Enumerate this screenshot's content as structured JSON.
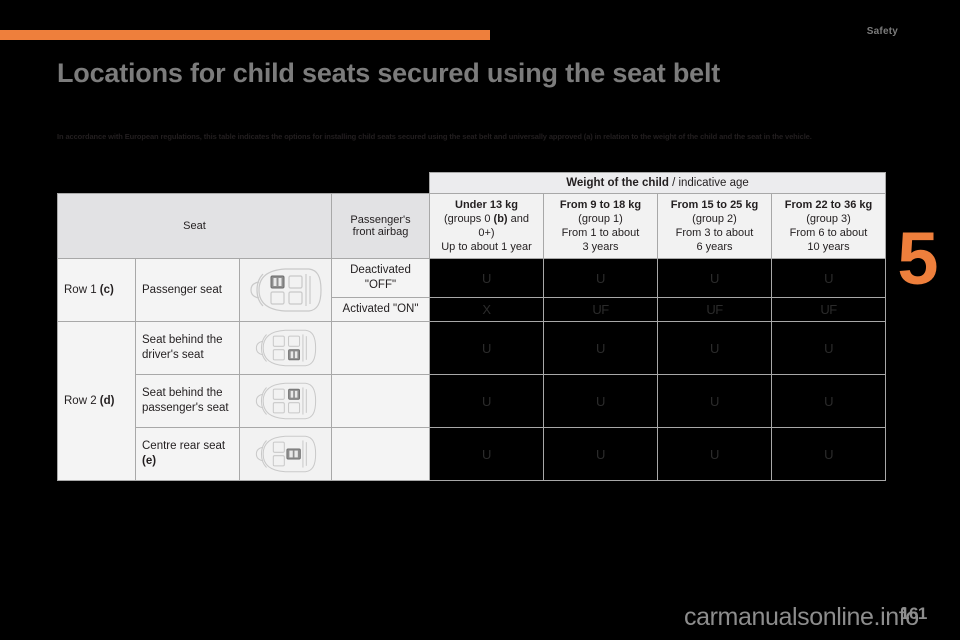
{
  "page": {
    "section_tag": "Safety",
    "chapter_number": "5",
    "title": "Locations for child seats secured using the seat belt",
    "intro": "In accordance with European regulations, this table indicates the options for installing child seats secured using the seat belt and universally approved (a) in relation to the weight of the child and the seat in the vehicle.",
    "watermark": "carmanualsonline.info",
    "folio": "161",
    "accent_color": "#ee7f3c",
    "title_color": "#7c7c7c"
  },
  "table": {
    "header": {
      "seat_label": "Seat",
      "airbag_label": "Passenger's front airbag",
      "weight_bold": "Weight of the child",
      "weight_light": " / indicative age",
      "weight_bands": [
        {
          "weight": "Under 13 kg",
          "group_pre": "(groups 0 ",
          "group_bold": "(b)",
          "group_post": " and 0+)",
          "age": "Up to about 1 year"
        },
        {
          "weight": "From 9 to 18 kg",
          "group": "(group 1)",
          "age1": "From 1 to about",
          "age2": "3 years"
        },
        {
          "weight": "From 15 to 25 kg",
          "group": "(group 2)",
          "age1": "From 3 to about",
          "age2": "6 years"
        },
        {
          "weight": "From 22 to 36 kg",
          "group": "(group 3)",
          "age1": "From 6 to about",
          "age2": "10 years"
        }
      ]
    },
    "rows": [
      {
        "row_group": "Row 1 ",
        "row_group_bold": "(c)",
        "seat": "Passenger seat",
        "airbag": "Deactivated \"OFF\"",
        "cells": [
          "U",
          "U",
          "U",
          "U"
        ]
      },
      {
        "row_group": "",
        "row_group_bold": "",
        "seat": "Passenger seat",
        "airbag": "Activated \"ON\"",
        "cells": [
          "X",
          "UF",
          "UF",
          "UF"
        ]
      },
      {
        "row_group": "Row 2 ",
        "row_group_bold": "(d)",
        "seat": "Seat behind the driver's seat",
        "airbag": "",
        "cells": [
          "U",
          "U",
          "U",
          "U"
        ]
      },
      {
        "row_group": "",
        "row_group_bold": "",
        "seat": "Seat behind the passenger's seat",
        "airbag": "",
        "cells": [
          "U",
          "U",
          "U",
          "U"
        ]
      },
      {
        "row_group": "",
        "row_group_bold": "",
        "seat_pre": "Centre rear seat ",
        "seat_bold": "(e)",
        "airbag": "",
        "cells": [
          "U",
          "U",
          "U",
          "U"
        ]
      }
    ]
  }
}
